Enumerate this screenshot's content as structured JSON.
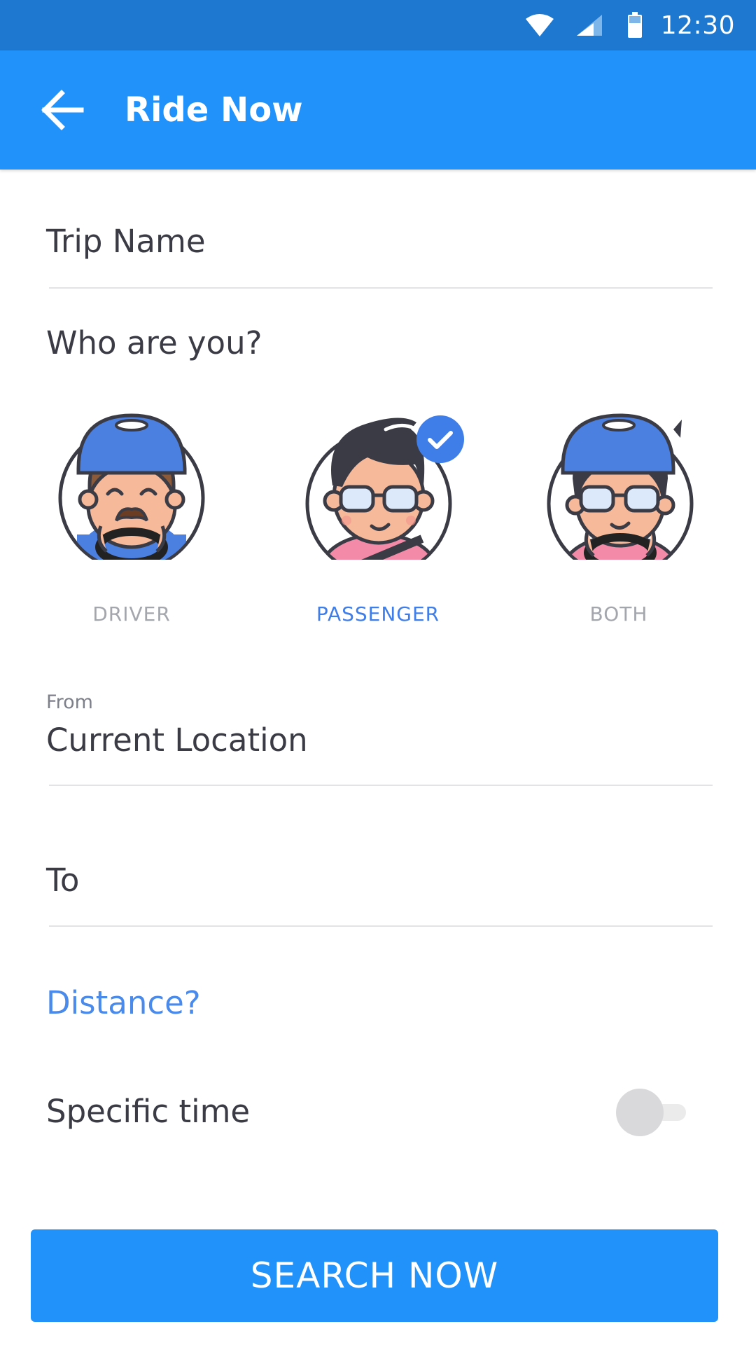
{
  "status_bar": {
    "time": "12:30",
    "icons": [
      "wifi-icon",
      "signal-icon",
      "battery-icon"
    ]
  },
  "app_bar": {
    "title": "Ride Now",
    "back_icon": "arrow-left-icon"
  },
  "trip_name": {
    "placeholder": "Trip Name"
  },
  "role_section": {
    "question": "Who are you?",
    "options": [
      {
        "label": "DRIVER",
        "selected": false
      },
      {
        "label": "PASSENGER",
        "selected": true
      },
      {
        "label": "BOTH",
        "selected": false
      }
    ]
  },
  "from": {
    "label": "From",
    "value": "Current Location"
  },
  "to": {
    "placeholder": "To"
  },
  "distance": {
    "link": "Distance?"
  },
  "specific_time": {
    "label": "Specific time",
    "enabled": false
  },
  "search": {
    "button": "SEARCH NOW"
  },
  "colors": {
    "primary": "#2292fb",
    "status_bar": "#1f78cf",
    "accent": "#3f7de8",
    "muted": "#a3a6ad"
  }
}
